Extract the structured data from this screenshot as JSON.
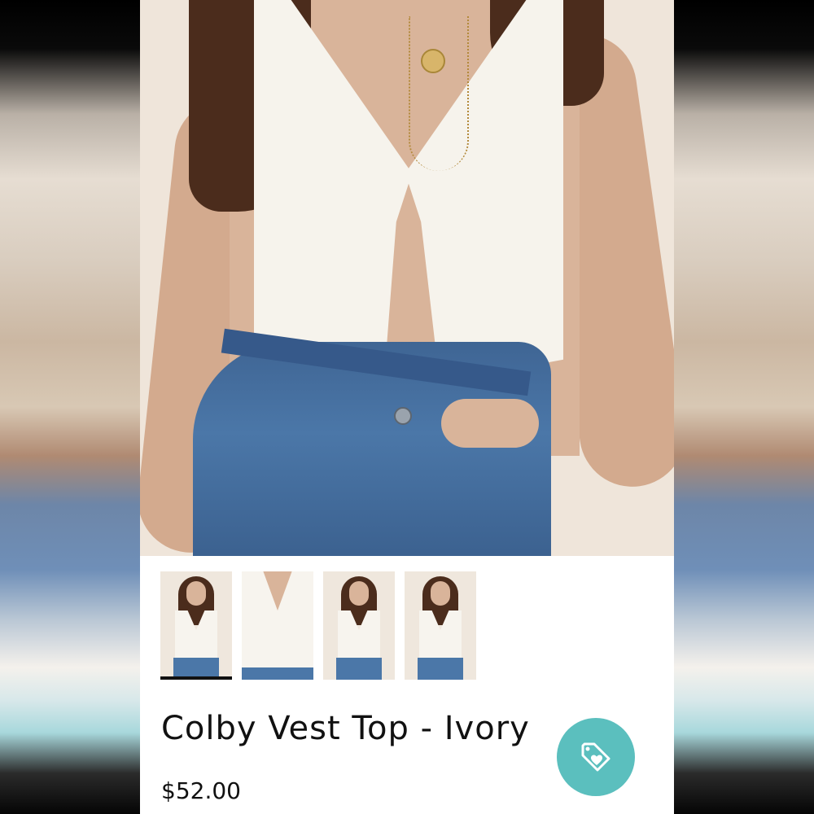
{
  "product": {
    "title": "Colby Vest Top - Ivory",
    "price": "$52.00"
  },
  "gallery": {
    "main_image_subject": "model wearing ivory knit vest top with jeans",
    "thumbnails": [
      {
        "name": "front-full",
        "selected": true
      },
      {
        "name": "front-close",
        "selected": false
      },
      {
        "name": "angle-full",
        "selected": false
      },
      {
        "name": "pose-full",
        "selected": false
      }
    ]
  },
  "fab": {
    "icon": "tag-heart-icon",
    "color": "#5bbfbe"
  },
  "colors": {
    "accent": "#5bbfbe",
    "text": "#111111",
    "selected_indicator": "#111111"
  }
}
